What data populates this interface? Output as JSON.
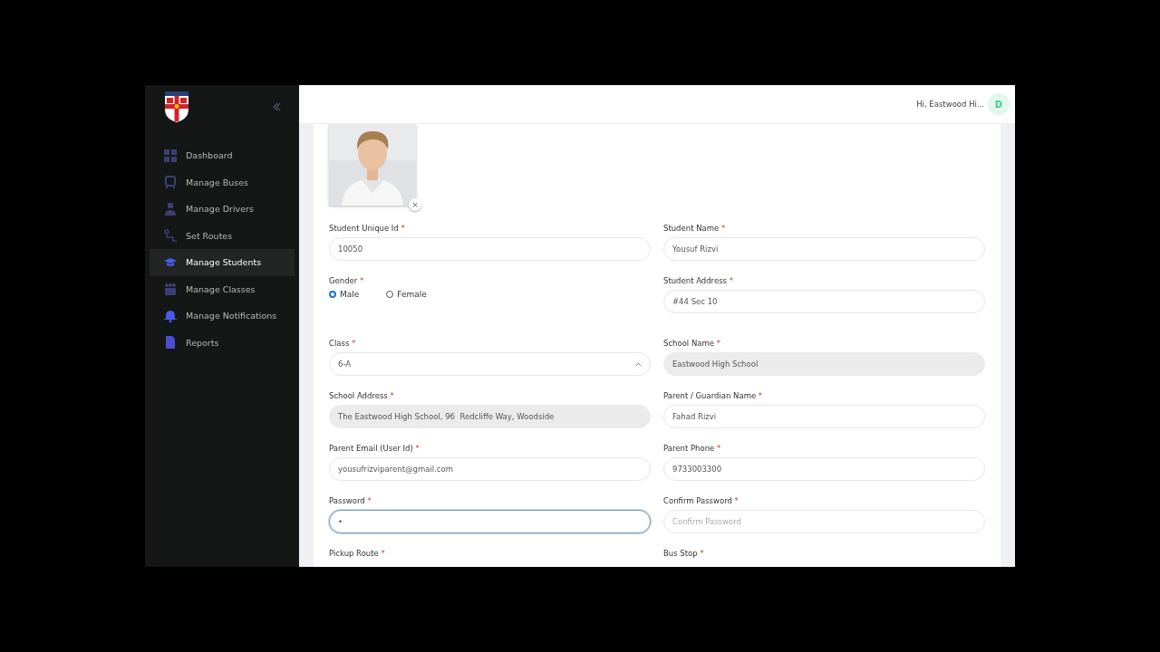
{
  "sidebar": {
    "items": [
      {
        "label": "Dashboard",
        "selected": false
      },
      {
        "label": "Manage Buses",
        "selected": false
      },
      {
        "label": "Manage Drivers",
        "selected": false
      },
      {
        "label": "Set Routes",
        "selected": false
      },
      {
        "label": "Manage Students",
        "selected": true
      },
      {
        "label": "Manage Classes",
        "selected": false
      },
      {
        "label": "Manage Notifications",
        "selected": false
      },
      {
        "label": "Reports",
        "selected": false
      }
    ]
  },
  "header": {
    "greeting": "Hi, Eastwood Hi...",
    "avatar": "D"
  },
  "photo": {
    "kind": "picture",
    "remove_button": "×"
  },
  "fields": [
    {
      "kind": "text",
      "label": "Student Unique Id",
      "mark": "*",
      "value": "10050",
      "disabled": false,
      "focused": false
    },
    {
      "kind": "text",
      "label": "Student Name",
      "mark": "*",
      "value": "Yousuf Rizvi",
      "disabled": false,
      "focused": false
    },
    {
      "kind": "radio",
      "label": "Gender",
      "mark": "*",
      "options": [
        {
          "label": "Male",
          "selected": true
        },
        {
          "label": "Female",
          "selected": false
        }
      ]
    },
    {
      "kind": "text",
      "label": "Student Address",
      "mark": "*",
      "value": "#44 Sec 10",
      "disabled": false,
      "focused": false
    },
    {
      "kind": "select",
      "label": "Class",
      "mark": "*",
      "value": "6-A",
      "disabled": false,
      "focused": false
    },
    {
      "kind": "text",
      "label": "School Name",
      "mark": "*",
      "value": "Eastwood High School",
      "disabled": true,
      "focused": false
    },
    {
      "kind": "text",
      "label": "School Address",
      "mark": "*",
      "value": "The Eastwood High School, 96  Redcliffe Way, Woodside",
      "disabled": true,
      "focused": false
    },
    {
      "kind": "text",
      "label": "Parent / Guardian Name",
      "mark": "*",
      "value": "Fahad Rizvi",
      "disabled": false,
      "focused": false
    },
    {
      "kind": "text",
      "label": "Parent Email (User Id)",
      "mark": "*",
      "value": "yousufrizviparent@gmail.com",
      "disabled": false,
      "focused": false
    },
    {
      "kind": "text",
      "label": "Parent Phone",
      "mark": "*",
      "value": "9733003300",
      "disabled": false,
      "focused": false
    },
    {
      "kind": "password",
      "label": "Password",
      "mark": "*",
      "value": "•",
      "disabled": false,
      "focused": true
    },
    {
      "kind": "password",
      "label": "Confirm Password",
      "mark": "*",
      "placeholder": "Confirm Password",
      "disabled": false,
      "focused": false
    },
    {
      "kind": "label",
      "label": "Pickup Route",
      "mark": "*"
    },
    {
      "kind": "label",
      "label": "Bus Stop",
      "mark": "*"
    }
  ]
}
